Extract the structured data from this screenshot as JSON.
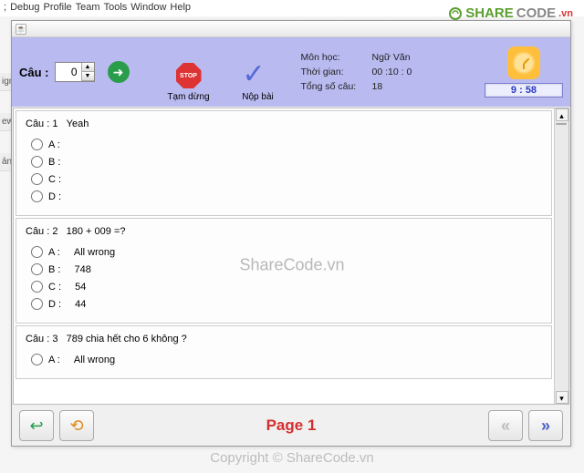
{
  "menubar": [
    "Debug",
    "Profile",
    "Team",
    "Tools",
    "Window",
    "Help"
  ],
  "side_labels": [
    "ign",
    "ew D",
    "ản h"
  ],
  "watermark": {
    "brand_left": "SHARE",
    "brand_right": "CODE",
    "tld": ".vn",
    "center": "ShareCode.vn",
    "copyright": "Copyright © ShareCode.vn"
  },
  "header": {
    "cau_label": "Câu :",
    "spinner_value": "0",
    "pause_label": "Tạm dừng",
    "submit_label": "Nộp bài",
    "stop_text": "STOP",
    "info": {
      "subject_k": "Môn học:",
      "subject_v": "Ngữ Văn",
      "time_k": "Thời gian:",
      "time_v": "00 :10 : 0",
      "total_k": "Tổng số câu:",
      "total_v": "18"
    },
    "timer": "9 : 58"
  },
  "questions": [
    {
      "num": "Câu : 1",
      "text": "Yeah",
      "opts": {
        "A": "",
        "B": "",
        "C": "",
        "D": ""
      }
    },
    {
      "num": "Câu : 2",
      "text": "180  + 009 =?",
      "opts": {
        "A": "All wrong",
        "B": "748",
        "C": "54",
        "D": "44"
      }
    },
    {
      "num": "Câu : 3",
      "text": "789 chia hết cho 6 không ?",
      "opts": {
        "A": "All wrong"
      }
    }
  ],
  "footer": {
    "page": "Page 1"
  }
}
